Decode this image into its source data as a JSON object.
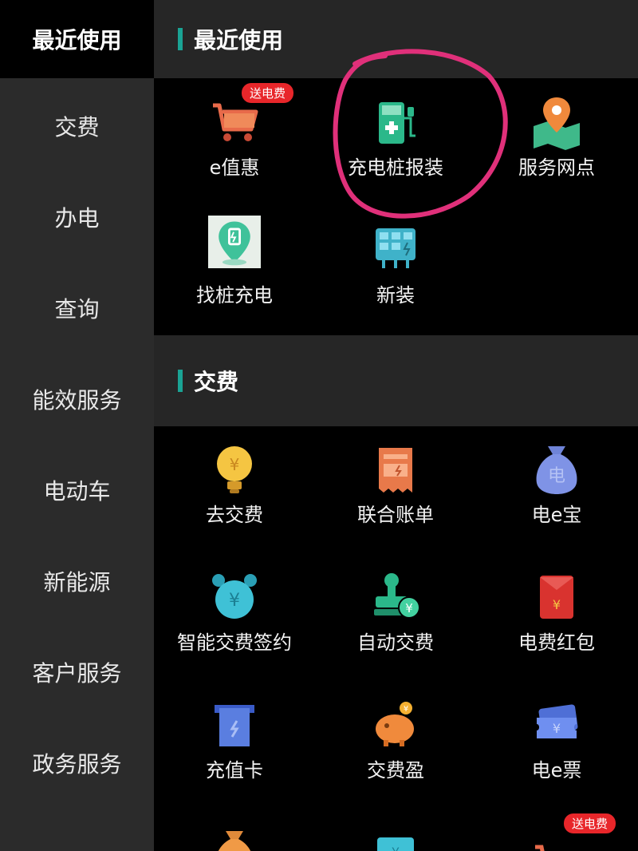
{
  "sidebar": {
    "items": [
      {
        "label": "最近使用",
        "active": true
      },
      {
        "label": "交费"
      },
      {
        "label": "办电"
      },
      {
        "label": "查询"
      },
      {
        "label": "能效服务"
      },
      {
        "label": "电动车"
      },
      {
        "label": "新能源"
      },
      {
        "label": "客户服务"
      },
      {
        "label": "政务服务"
      }
    ]
  },
  "sections": {
    "recent": {
      "title": "最近使用",
      "items": [
        {
          "label": "e值惠",
          "icon": "shopping-cart-icon",
          "badge": "送电费"
        },
        {
          "label": "充电桩报装",
          "icon": "charging-pile-icon"
        },
        {
          "label": "服务网点",
          "icon": "map-pin-icon"
        },
        {
          "label": "找桩充电",
          "icon": "find-charger-icon"
        },
        {
          "label": "新装",
          "icon": "solar-panel-icon"
        }
      ]
    },
    "payment": {
      "title": "交费",
      "items": [
        {
          "label": "去交费",
          "icon": "lightbulb-yen-icon"
        },
        {
          "label": "联合账单",
          "icon": "bill-icon"
        },
        {
          "label": "电e宝",
          "icon": "money-bag-icon"
        },
        {
          "label": "智能交费签约",
          "icon": "alarm-clock-yen-icon"
        },
        {
          "label": "自动交费",
          "icon": "stamp-yen-icon"
        },
        {
          "label": "电费红包",
          "icon": "red-envelope-icon"
        },
        {
          "label": "充值卡",
          "icon": "recharge-card-icon"
        },
        {
          "label": "交费盈",
          "icon": "piggy-bank-icon"
        },
        {
          "label": "电e票",
          "icon": "ticket-yen-icon"
        }
      ],
      "partial_row_badge": "送电费"
    }
  },
  "colors": {
    "accent": "#1aa394",
    "annotation": "#e0307a",
    "badge": "#e8262a",
    "sidebar_bg": "#2b2b2b",
    "section_header_bg": "#262626"
  }
}
